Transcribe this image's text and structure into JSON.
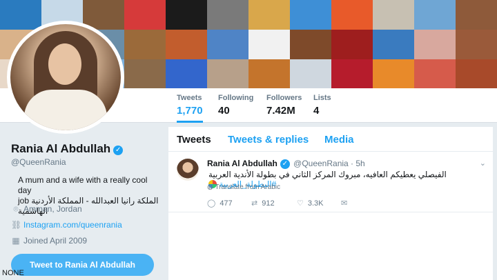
{
  "header": {
    "tile_colors": [
      "#2a7bbf",
      "#c6d9e8",
      "#7f5a3a",
      "#d63a3a",
      "#1b1b1b",
      "#7a7a7a",
      "#d9a74b",
      "#3e8fd6",
      "#e85a2a",
      "#c7c0b2",
      "#6fa6d4",
      "#8e5a3a",
      "#d9b28a",
      "#e9b9a4",
      "#6a8ea8",
      "#9b6a3a",
      "#c25d2d",
      "#4f84c6",
      "#f1f1f1",
      "#7e4a2a",
      "#9e1e1e",
      "#3a7bbf",
      "#d8a89e",
      "#9a5a3a",
      "#e8d8c8",
      "#f2a45a",
      "#7cb0dc",
      "#8a6a4a",
      "#3366cc",
      "#b7a08a",
      "#c4742c",
      "#cfd7df",
      "#b61c2c",
      "#e88a2a",
      "#d65b4b",
      "#a84a2a"
    ]
  },
  "stats": [
    {
      "label": "Tweets",
      "value": "1,770"
    },
    {
      "label": "Following",
      "value": "40"
    },
    {
      "label": "Followers",
      "value": "7.42M"
    },
    {
      "label": "Lists",
      "value": "4"
    }
  ],
  "profile": {
    "name": "Rania Al Abdullah",
    "handle": "@QueenRania",
    "bio_line1": "A mum and a wife with a really cool day",
    "bio_line2": "job الملكة رانيا العبدالله - المملكة الأردنية الهاشمية",
    "location": "Amman, Jordan",
    "website": "Instagram.com/queenrania",
    "joined": "Joined April 2009",
    "tweet_button": "Tweet to Rania Al Abdullah"
  },
  "watermark": "NONE",
  "tabs": [
    {
      "label": "Tweets"
    },
    {
      "label": "Tweets & replies"
    },
    {
      "label": "Media"
    }
  ],
  "tweet": {
    "name": "Rania Al Abdullah",
    "handle": "@QueenRania · 5h",
    "text": "الفيصلي يعطيكم العافيه، مبروك المركز الثاني في بطولة الأندية العربية",
    "hashtag": "#البطولة_العربية",
    "translate": "Translate from Arabic",
    "replies": "477",
    "retweets": "912",
    "likes": "3.3K"
  },
  "icons": {
    "verified": "verified-badge-icon",
    "location": "location-pin-icon",
    "link": "link-icon",
    "calendar": "calendar-icon",
    "globe": "globe-icon",
    "reply": "reply-icon",
    "retweet": "retweet-icon",
    "like": "heart-icon",
    "dm": "envelope-icon",
    "more": "chevron-down-icon"
  },
  "colors": {
    "accent": "#1da1f2",
    "button": "#4ab3f4",
    "background": "#e6ecf0"
  }
}
